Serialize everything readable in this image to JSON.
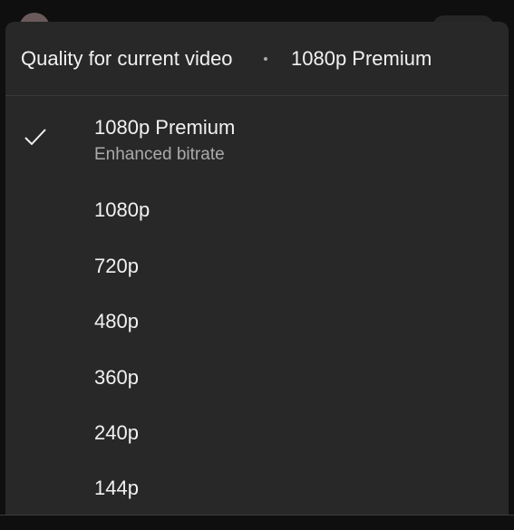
{
  "header": {
    "title": "Quality for current video",
    "current": "1080p Premium"
  },
  "options": [
    {
      "label": "1080p Premium",
      "sublabel": "Enhanced bitrate",
      "selected": true
    },
    {
      "label": "1080p"
    },
    {
      "label": "720p"
    },
    {
      "label": "480p"
    },
    {
      "label": "360p"
    },
    {
      "label": "240p"
    },
    {
      "label": "144p"
    }
  ],
  "colors": {
    "background": "#0f0f0f",
    "sheet": "#282828",
    "text_primary": "#f1f1f1",
    "text_secondary": "#aaaaaa"
  },
  "icons": {
    "selected_marker": "check-icon"
  }
}
